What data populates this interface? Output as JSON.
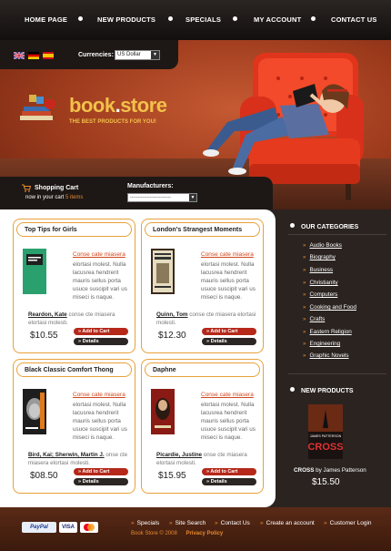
{
  "nav": {
    "items": [
      "HOME PAGE",
      "NEW PRODUCTS",
      "SPECIALS",
      "MY ACCOUNT",
      "CONTACT US"
    ]
  },
  "currency": {
    "label": "Currencies:",
    "selected": "US Dollar",
    "flags": [
      "uk-flag-icon",
      "germany-flag-icon",
      "spain-flag-icon"
    ]
  },
  "logo": {
    "title": "book",
    "dot": ".",
    "title2": "store",
    "subtitle": "THE BEST PRODUCTS FOR YOU!"
  },
  "cart": {
    "title": "Shopping Cart",
    "sub_prefix": "now in your cart",
    "count": "5 items"
  },
  "manufacturers": {
    "label": "Manufacturers:",
    "selected": "---------------------------"
  },
  "products": [
    {
      "heading": "Top Tips for Girls",
      "link": "Conse cate miasera",
      "desc": "elortasi molest. Nulla lacusrea hendrerit mauris sellus porta usuce suscipit vari us miseci is naque.",
      "author": "Reardon, Kate",
      "author_tail": "conse cte miasera elortasi molesti.",
      "price": "$10.55",
      "add": "Add to Cart",
      "details": "Details"
    },
    {
      "heading": "London's Strangest Moments",
      "link": "Conse cate miasera",
      "desc": "elortasi molest. Nulla lacusrea hendrerit mauris sellus porta usuce suscipit vari us miseci is naque.",
      "author": "Quinn, Tom",
      "author_tail": "conse cte miasera elortasi molesti.",
      "price": "$12.30",
      "add": "Add to Cart",
      "details": "Details"
    },
    {
      "heading": "Black Classic Comfort Thong",
      "link": "Conse cate miasera",
      "desc": "elortasi molest. Nulla lacusrea hendrerit mauris sellus porta usuce suscipit vari us miseci is naque.",
      "author": "Bird, Kai; Sherwin, Martin J.",
      "author_tail": "onse cte miasera elortasi molesti.",
      "price": "$08.50",
      "add": "Add to Cart",
      "details": "Details"
    },
    {
      "heading": "Daphne",
      "link": "Conse cate miasera",
      "desc": "elortasi molest. Nulla lacusrea hendrerit mauris sellus porta usuce suscipit vari us miseci is naque.",
      "author": "Picardie, Justine",
      "author_tail": "onse cte miasera elortasi molesti.",
      "price": "$15.95",
      "add": "Add to Cart",
      "details": "Details"
    }
  ],
  "categories": {
    "title": "OUR CATEGORIES",
    "items": [
      "Audio Books",
      "Biography",
      "Business",
      "Christianity",
      "Computers",
      "Cooking and Food",
      "Crafts",
      "Eastern Religion",
      "Engineering",
      "Graphic Novels"
    ]
  },
  "new_products": {
    "title": "NEW PRODUCTS",
    "book_name": "CROSS",
    "by": "by James Patterson",
    "price": "$15.50",
    "cover_author": "JAMES PATTERSON",
    "cover_title": "CROSS"
  },
  "footer": {
    "links": [
      "Specials",
      "Site Search",
      "Contact Us",
      "Create an account",
      "Customer Login"
    ],
    "copyright": "Book Store © 2008",
    "privacy": "Privacy Policy",
    "payments": [
      "PayPal",
      "VISA",
      "MasterCard"
    ]
  },
  "colors": {
    "accent": "#e58a2e",
    "button_red": "#b5281a",
    "card_border": "#e8a13a",
    "dark": "#2a2320"
  }
}
